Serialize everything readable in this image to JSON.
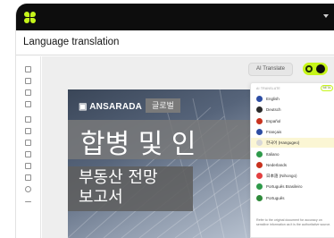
{
  "app": {
    "title": "Language translation"
  },
  "sidebar": {
    "icons": [
      "document-icon",
      "bookmark-icon",
      "pages-icon",
      "image-icon",
      "list-icon",
      "grid-icon",
      "folder-icon",
      "note-icon",
      "chat-icon",
      "mail-icon",
      "settings-icon",
      "arrow-right-icon"
    ]
  },
  "toolbar": {
    "ai_translate_label": "AI Translate",
    "toggle_state": "on"
  },
  "document": {
    "brand": "ANSARADA",
    "brand_tag": "글로벌",
    "headline": "합병 및 인",
    "subtitle_line1": "부동산 전망",
    "subtitle_line2": "보고서"
  },
  "translate_panel": {
    "header": "AI TRANSLATE",
    "badge": "BETA",
    "languages": [
      {
        "label": "English",
        "color": "#2d4da3",
        "selected": false
      },
      {
        "label": "Deutsch",
        "color": "#2a2a2a",
        "selected": false
      },
      {
        "label": "Español",
        "color": "#c8321e",
        "selected": false
      },
      {
        "label": "Français",
        "color": "#2d4da3",
        "selected": false
      },
      {
        "label": "한국어 (Hangugeo)",
        "color": "#d8d8d8",
        "selected": true
      },
      {
        "label": "Italiano",
        "color": "#2e9a4a",
        "selected": false
      },
      {
        "label": "Nederlands",
        "color": "#c8321e",
        "selected": false
      },
      {
        "label": "日本語 (Nihongo)",
        "color": "#e34040",
        "selected": false
      },
      {
        "label": "Português Brasileiro",
        "color": "#2e9a4a",
        "selected": false
      },
      {
        "label": "Português",
        "color": "#2e8a3a",
        "selected": false
      }
    ],
    "note": "Refer to the original document for accuracy on sensitive information as it is the authoritative source."
  }
}
